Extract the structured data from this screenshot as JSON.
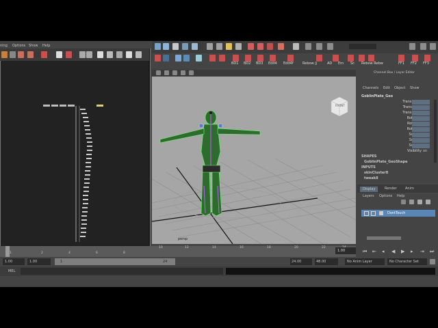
{
  "hypergraph": {
    "menu": [
      "ning",
      "Options",
      "Show",
      "Help"
    ]
  },
  "toolbar": {
    "shelf_tabs": [
      "BD1",
      "BD2",
      "BD3",
      "Edit4",
      "Edit4f",
      "Rebow jj",
      "AD",
      "Em",
      "Sc",
      "Rebow Rebw",
      "FF1",
      "FF2",
      "FF3"
    ]
  },
  "channel_box": {
    "title": "Channel Box / Layer Editor",
    "menu": [
      "Channels",
      "Edit",
      "Object",
      "Show"
    ],
    "object_name": "GoblinPlate_Geo",
    "attributes": [
      "Translate X",
      "Translate Y",
      "Translate Z",
      "Rotate X",
      "Rotate Y",
      "Rotate Z",
      "Scale X",
      "Scale Y",
      "Scale Z",
      "Visibility"
    ],
    "visibility_value": "on",
    "shapes_header": "SHAPES",
    "shape_name": "GoblinPlate_GeoShape",
    "inputs_header": "INPUTS",
    "inputs": [
      "skinCluster8",
      "tweak8"
    ]
  },
  "layer_editor": {
    "tabs": [
      "Display",
      "Render",
      "Anim"
    ],
    "menu": [
      "Layers",
      "Options",
      "Help"
    ],
    "layer_name": "DontTouch"
  },
  "viewport": {
    "camera_label": "persp",
    "viewcube_label": "FRONT"
  },
  "timeline": {
    "ticks": [
      "1",
      "2",
      "4",
      "6",
      "8",
      "10",
      "12",
      "14",
      "16",
      "18",
      "20",
      "22",
      "24"
    ],
    "current_frame": "1.00"
  },
  "range": {
    "start": "1.00",
    "start2": "1.00",
    "slider_start": "1",
    "slider_end": "24",
    "end": "24.00",
    "end2": "48.00",
    "anim_layer": "No Anim Layer",
    "char_set": "No Character Set"
  },
  "cmdline": {
    "label": "MEL"
  }
}
